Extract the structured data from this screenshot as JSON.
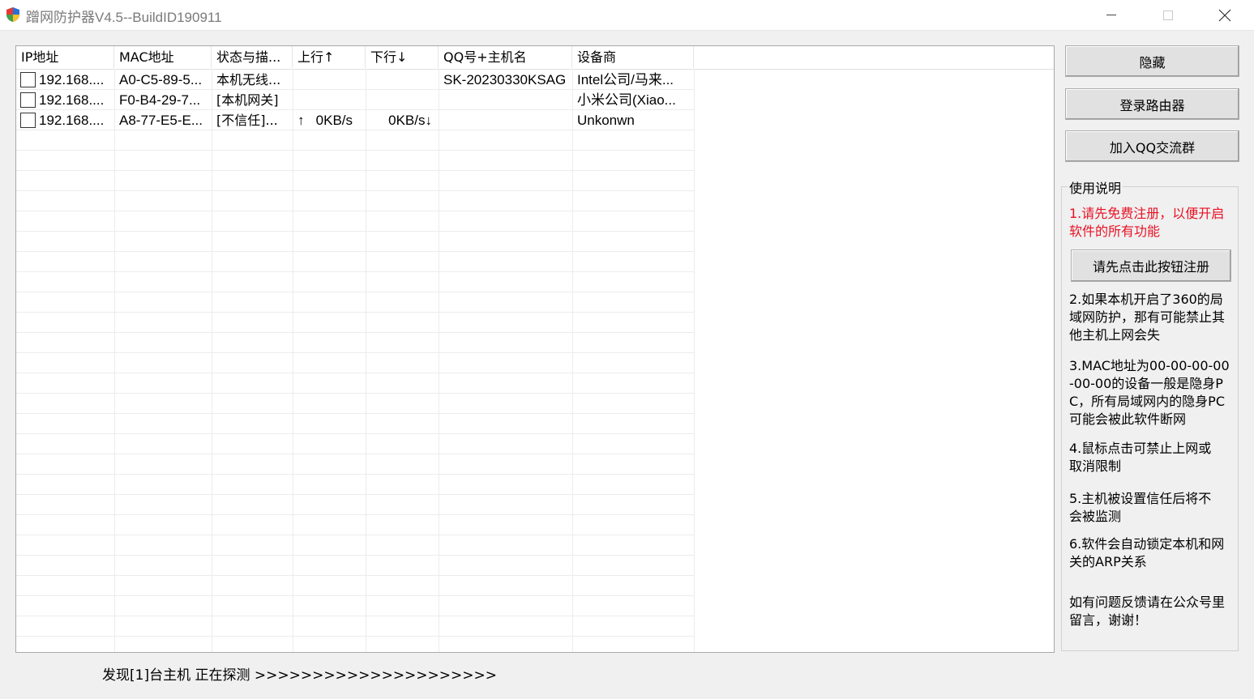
{
  "window": {
    "title": "蹭网防护器V4.5--BuildID190911"
  },
  "table": {
    "columns": [
      "IP地址",
      "MAC地址",
      "状态与描...",
      "上行↑",
      "下行↓",
      "QQ号+主机名",
      "设备商"
    ],
    "rows": [
      {
        "ip": "192.168....",
        "mac": "A0-C5-89-5...",
        "status": "本机无线...",
        "up": "",
        "down": "",
        "qq": "SK-20230330KSAG",
        "vendor": "Intel公司/马来..."
      },
      {
        "ip": "192.168....",
        "mac": "F0-B4-29-7...",
        "status": "[本机网关]",
        "up": "",
        "down": "",
        "qq": "",
        "vendor": "小米公司(Xiao..."
      },
      {
        "ip": "192.168....",
        "mac": "A8-77-E5-E...",
        "status": "[不信任]...",
        "up": "↑   0KB/s",
        "down": "0KB/s↓",
        "qq": "",
        "vendor": "Unkonwn"
      }
    ]
  },
  "buttons": {
    "hide": "隐藏",
    "login_router": "登录路由器",
    "join_qq": "加入QQ交流群",
    "register": "请先点击此按钮注册"
  },
  "instructions": {
    "title": "使用说明",
    "note1": "1.请先免费注册，以便开启软件的所有功能",
    "note2": "2.如果本机开启了360的局域网防护，那有可能禁止其他主机上网会失",
    "note3": "3.MAC地址为00-00-00-00-00-00的设备一般是隐身PC，所有局域网内的隐身PC可能会被此软件断网",
    "note4": "4.鼠标点击可禁止上网或取消限制",
    "note5": "5.主机被设置信任后将不会被监测",
    "note6": "6.软件会自动锁定本机和网关的ARP关系",
    "feedback": "如有问题反馈请在公众号里留言，谢谢！"
  },
  "status_bar": {
    "text": "发现[1]台主机  正在探测 >>>>>>>>>>>>>>>>>>>>>"
  },
  "colors": {
    "warning_text": "#e81123",
    "background": "#f0f0f0"
  }
}
